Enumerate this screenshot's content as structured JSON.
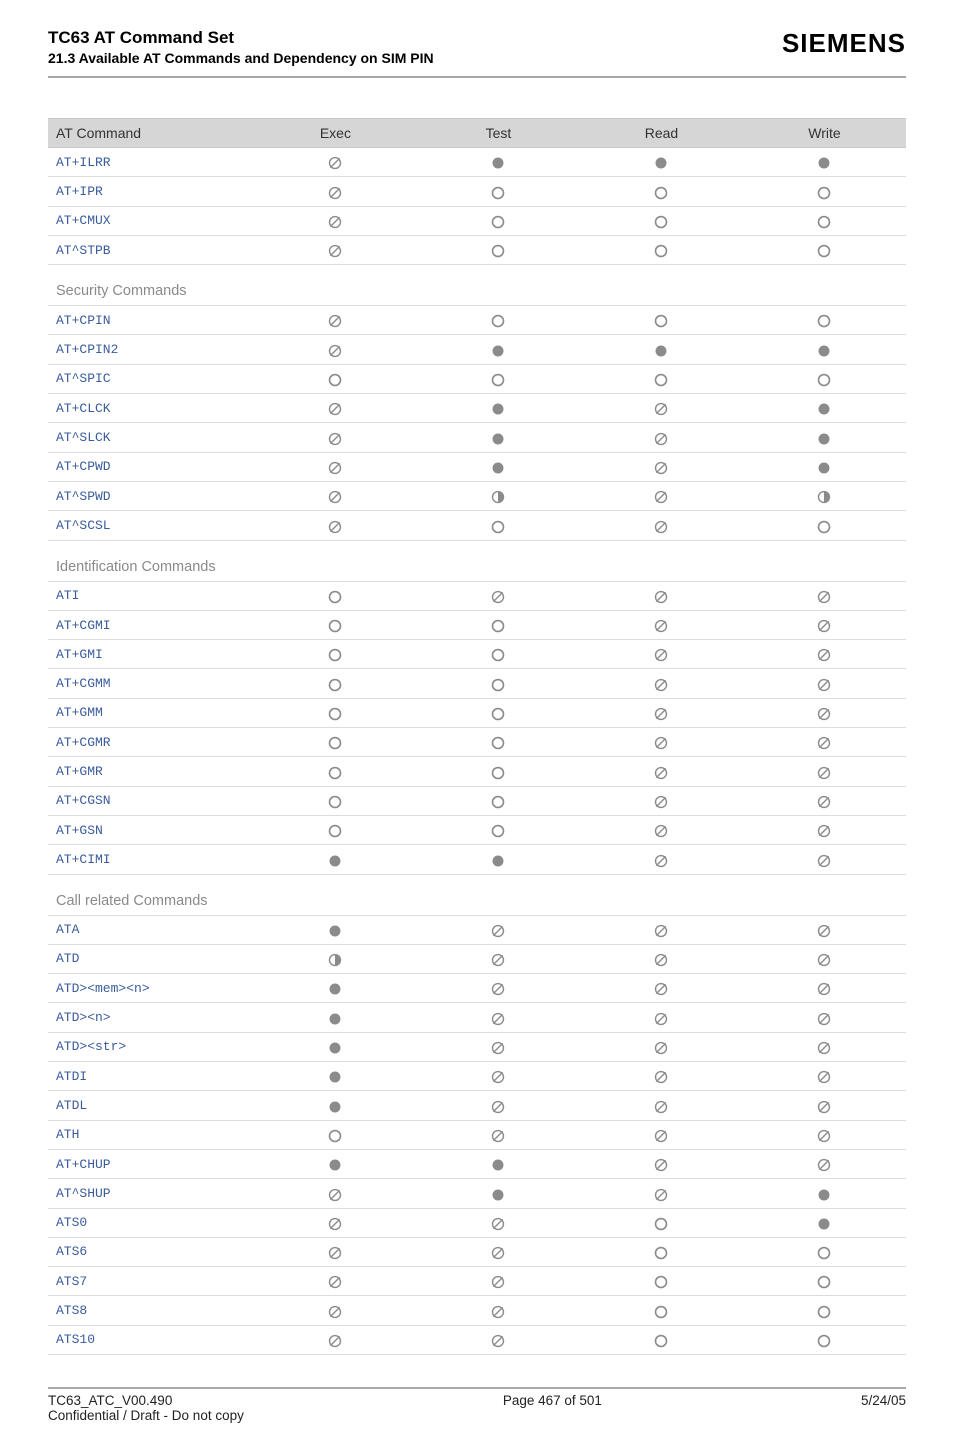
{
  "header": {
    "title": "TC63 AT Command Set",
    "subtitle": "21.3 Available AT Commands and Dependency on SIM PIN",
    "brand": "SIEMENS"
  },
  "table_header": {
    "command": "AT Command",
    "exec": "Exec",
    "test": "Test",
    "read": "Read",
    "write": "Write"
  },
  "sections": [
    {
      "title": "",
      "rows": [
        {
          "cmd": "AT+ILRR",
          "exec": "na",
          "test": "req",
          "read": "req",
          "write": "req"
        },
        {
          "cmd": "AT+IPR",
          "exec": "na",
          "test": "nopin",
          "read": "nopin",
          "write": "nopin"
        },
        {
          "cmd": "AT+CMUX",
          "exec": "na",
          "test": "nopin",
          "read": "nopin",
          "write": "nopin"
        },
        {
          "cmd": "AT^STPB",
          "exec": "na",
          "test": "nopin",
          "read": "nopin",
          "write": "nopin"
        }
      ]
    },
    {
      "title": "Security Commands",
      "rows": [
        {
          "cmd": "AT+CPIN",
          "exec": "na",
          "test": "nopin",
          "read": "nopin",
          "write": "nopin"
        },
        {
          "cmd": "AT+CPIN2",
          "exec": "na",
          "test": "req",
          "read": "req",
          "write": "req"
        },
        {
          "cmd": "AT^SPIC",
          "exec": "nopin",
          "test": "nopin",
          "read": "nopin",
          "write": "nopin"
        },
        {
          "cmd": "AT+CLCK",
          "exec": "na",
          "test": "req",
          "read": "na",
          "write": "req"
        },
        {
          "cmd": "AT^SLCK",
          "exec": "na",
          "test": "req",
          "read": "na",
          "write": "req"
        },
        {
          "cmd": "AT+CPWD",
          "exec": "na",
          "test": "req",
          "read": "na",
          "write": "req"
        },
        {
          "cmd": "AT^SPWD",
          "exec": "na",
          "test": "partial",
          "read": "na",
          "write": "partial"
        },
        {
          "cmd": "AT^SCSL",
          "exec": "na",
          "test": "nopin",
          "read": "na",
          "write": "nopin"
        }
      ]
    },
    {
      "title": "Identification Commands",
      "rows": [
        {
          "cmd": "ATI",
          "exec": "nopin",
          "test": "na",
          "read": "na",
          "write": "na"
        },
        {
          "cmd": "AT+CGMI",
          "exec": "nopin",
          "test": "nopin",
          "read": "na",
          "write": "na"
        },
        {
          "cmd": "AT+GMI",
          "exec": "nopin",
          "test": "nopin",
          "read": "na",
          "write": "na"
        },
        {
          "cmd": "AT+CGMM",
          "exec": "nopin",
          "test": "nopin",
          "read": "na",
          "write": "na"
        },
        {
          "cmd": "AT+GMM",
          "exec": "nopin",
          "test": "nopin",
          "read": "na",
          "write": "na"
        },
        {
          "cmd": "AT+CGMR",
          "exec": "nopin",
          "test": "nopin",
          "read": "na",
          "write": "na"
        },
        {
          "cmd": "AT+GMR",
          "exec": "nopin",
          "test": "nopin",
          "read": "na",
          "write": "na"
        },
        {
          "cmd": "AT+CGSN",
          "exec": "nopin",
          "test": "nopin",
          "read": "na",
          "write": "na"
        },
        {
          "cmd": "AT+GSN",
          "exec": "nopin",
          "test": "nopin",
          "read": "na",
          "write": "na"
        },
        {
          "cmd": "AT+CIMI",
          "exec": "req",
          "test": "req",
          "read": "na",
          "write": "na"
        }
      ]
    },
    {
      "title": "Call related Commands",
      "rows": [
        {
          "cmd": "ATA",
          "exec": "req",
          "test": "na",
          "read": "na",
          "write": "na"
        },
        {
          "cmd": "ATD",
          "exec": "partial",
          "test": "na",
          "read": "na",
          "write": "na"
        },
        {
          "cmd": "ATD><mem><n>",
          "exec": "req",
          "test": "na",
          "read": "na",
          "write": "na"
        },
        {
          "cmd": "ATD><n>",
          "exec": "req",
          "test": "na",
          "read": "na",
          "write": "na"
        },
        {
          "cmd": "ATD><str>",
          "exec": "req",
          "test": "na",
          "read": "na",
          "write": "na"
        },
        {
          "cmd": "ATDI",
          "exec": "req",
          "test": "na",
          "read": "na",
          "write": "na"
        },
        {
          "cmd": "ATDL",
          "exec": "req",
          "test": "na",
          "read": "na",
          "write": "na"
        },
        {
          "cmd": "ATH",
          "exec": "nopin",
          "test": "na",
          "read": "na",
          "write": "na"
        },
        {
          "cmd": "AT+CHUP",
          "exec": "req",
          "test": "req",
          "read": "na",
          "write": "na"
        },
        {
          "cmd": "AT^SHUP",
          "exec": "na",
          "test": "req",
          "read": "na",
          "write": "req"
        },
        {
          "cmd": "ATS0",
          "exec": "na",
          "test": "na",
          "read": "nopin",
          "write": "req"
        },
        {
          "cmd": "ATS6",
          "exec": "na",
          "test": "na",
          "read": "nopin",
          "write": "nopin"
        },
        {
          "cmd": "ATS7",
          "exec": "na",
          "test": "na",
          "read": "nopin",
          "write": "nopin"
        },
        {
          "cmd": "ATS8",
          "exec": "na",
          "test": "na",
          "read": "nopin",
          "write": "nopin"
        },
        {
          "cmd": "ATS10",
          "exec": "na",
          "test": "na",
          "read": "nopin",
          "write": "nopin"
        }
      ]
    }
  ],
  "footer": {
    "doc_code": "TC63_ATC_V00.490",
    "page": "Page 467 of 501",
    "date": "5/24/05",
    "notice": "Confidential / Draft - Do not copy"
  },
  "symbols": {
    "na": "∅",
    "nopin": "○",
    "req": "●",
    "partial": "◐"
  }
}
